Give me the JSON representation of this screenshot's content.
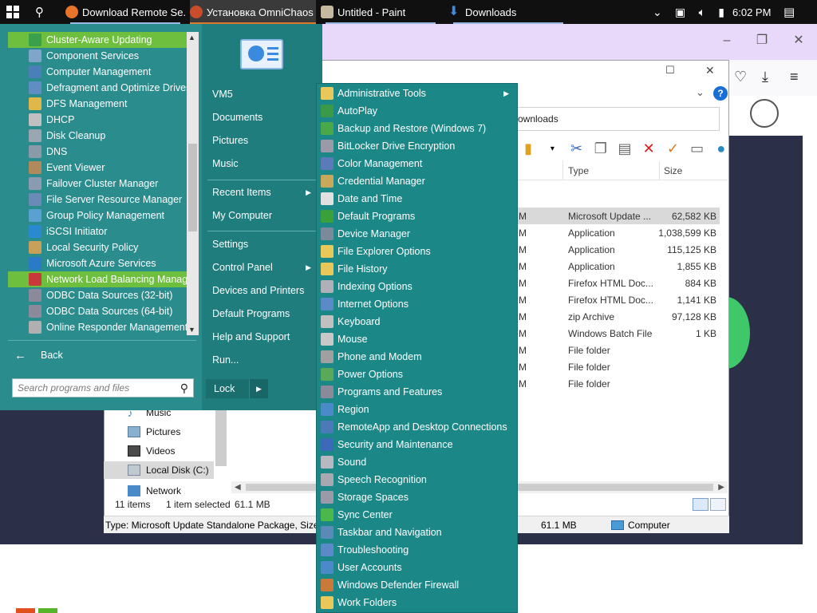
{
  "taskbar": {
    "apps": [
      {
        "label": "Download Remote Se...",
        "color": "#e8742a"
      },
      {
        "label": "Установка OmniChaos",
        "color": "#c94d2a"
      },
      {
        "label": "Untitled - Paint",
        "color": "#c7b8a0"
      },
      {
        "label": "Downloads",
        "color": "#3f8be0"
      }
    ],
    "time": "6:02 PM"
  },
  "explorer": {
    "address": "ownloads",
    "columns": {
      "type": "Type",
      "size": "Size"
    },
    "files": [
      {
        "date": "M",
        "type": "Microsoft Update ...",
        "size": "62,582 KB",
        "selected": true
      },
      {
        "date": "M",
        "type": "Application",
        "size": "1,038,599 KB"
      },
      {
        "date": "M",
        "type": "Application",
        "size": "115,125 KB"
      },
      {
        "date": "M",
        "type": "Application",
        "size": "1,855 KB"
      },
      {
        "date": "M",
        "type": "Firefox HTML Doc...",
        "size": "884 KB"
      },
      {
        "date": "M",
        "type": "Firefox HTML Doc...",
        "size": "1,141 KB"
      },
      {
        "date": "M",
        "type": "zip Archive",
        "size": "97,128 KB"
      },
      {
        "date": "M",
        "type": "Windows Batch File",
        "size": "1 KB"
      },
      {
        "date": "M",
        "type": "File folder",
        "size": ""
      },
      {
        "date": "M",
        "type": "File folder",
        "size": ""
      },
      {
        "date": "M",
        "type": "File folder",
        "size": ""
      }
    ],
    "nav": {
      "music": "Music",
      "pictures": "Pictures",
      "videos": "Videos",
      "local_disk": "Local Disk (C:)",
      "network": "Network"
    },
    "status": {
      "items": "11 items",
      "selected": "1 item selected",
      "size": "61.1 MB"
    },
    "info": {
      "type_text": "Type: Microsoft Update Standalone Package, Size:",
      "size": "61.1 MB",
      "location": "Computer"
    }
  },
  "start_menu": {
    "programs": [
      {
        "label": "Cluster-Aware Updating",
        "icon_color": "#3aa04a",
        "highlighted": true
      },
      {
        "label": "Component Services",
        "icon_color": "#7fa6c9"
      },
      {
        "label": "Computer Management",
        "icon_color": "#4a7fb8"
      },
      {
        "label": "Defragment and Optimize Drives",
        "icon_color": "#5f8fc2"
      },
      {
        "label": "DFS Management",
        "icon_color": "#e0b84a"
      },
      {
        "label": "DHCP",
        "icon_color": "#c0c0c0"
      },
      {
        "label": "Disk Cleanup",
        "icon_color": "#9aa6b0"
      },
      {
        "label": "DNS",
        "icon_color": "#8a9aa8"
      },
      {
        "label": "Event Viewer",
        "icon_color": "#b08a5a"
      },
      {
        "label": "Failover Cluster Manager",
        "icon_color": "#8a9ab0"
      },
      {
        "label": "File Server Resource Manager",
        "icon_color": "#6a8ab8"
      },
      {
        "label": "Group Policy Management",
        "icon_color": "#5aa0d0"
      },
      {
        "label": "iSCSI Initiator",
        "icon_color": "#2a8ad0"
      },
      {
        "label": "Local Security Policy",
        "icon_color": "#c8a05a"
      },
      {
        "label": "Microsoft Azure Services",
        "icon_color": "#2a7ac8"
      },
      {
        "label": "Network Load Balancing Manager",
        "icon_color": "#c83a3a",
        "highlighted": true
      },
      {
        "label": "ODBC Data Sources (32-bit)",
        "icon_color": "#8a8a9a"
      },
      {
        "label": "ODBC Data Sources (64-bit)",
        "icon_color": "#8a8a9a"
      },
      {
        "label": "Online Responder Management",
        "icon_color": "#b0b0b0"
      }
    ],
    "back_label": "Back",
    "search_placeholder": "Search programs and files",
    "right_links": [
      {
        "label": "VM5",
        "arrow": false
      },
      {
        "label": "Documents",
        "arrow": false
      },
      {
        "label": "Pictures",
        "arrow": false
      },
      {
        "label": "Music",
        "arrow": false
      },
      {
        "label": "Recent Items",
        "arrow": true
      },
      {
        "label": "My Computer",
        "arrow": false
      },
      {
        "label": "Settings",
        "arrow": false
      },
      {
        "label": "Control Panel",
        "arrow": true
      },
      {
        "label": "Devices and Printers",
        "arrow": false
      },
      {
        "label": "Default Programs",
        "arrow": false
      },
      {
        "label": "Help and Support",
        "arrow": false
      },
      {
        "label": "Run...",
        "arrow": false
      }
    ],
    "lock_label": "Lock"
  },
  "control_panel": {
    "items": [
      {
        "label": "Administrative Tools",
        "icon_color": "#e8c85a",
        "arrow": true
      },
      {
        "label": "AutoPlay",
        "icon_color": "#3a9a4a"
      },
      {
        "label": "Backup and Restore (Windows 7)",
        "icon_color": "#4aa84a"
      },
      {
        "label": "BitLocker Drive Encryption",
        "icon_color": "#9a9aa8"
      },
      {
        "label": "Color Management",
        "icon_color": "#5a7ab8"
      },
      {
        "label": "Credential Manager",
        "icon_color": "#c8a85a"
      },
      {
        "label": "Date and Time",
        "icon_color": "#e0e0e0"
      },
      {
        "label": "Default Programs",
        "icon_color": "#3aa03a"
      },
      {
        "label": "Device Manager",
        "icon_color": "#7a8a9a"
      },
      {
        "label": "File Explorer Options",
        "icon_color": "#e8c85a"
      },
      {
        "label": "File History",
        "icon_color": "#e8c85a"
      },
      {
        "label": "Indexing Options",
        "icon_color": "#b0b0b8"
      },
      {
        "label": "Internet Options",
        "icon_color": "#5a8ac8"
      },
      {
        "label": "Keyboard",
        "icon_color": "#c0c0c0"
      },
      {
        "label": "Mouse",
        "icon_color": "#c8c8c8"
      },
      {
        "label": "Phone and Modem",
        "icon_color": "#a0a0a0"
      },
      {
        "label": "Power Options",
        "icon_color": "#5aa85a"
      },
      {
        "label": "Programs and Features",
        "icon_color": "#8a8a9a"
      },
      {
        "label": "Region",
        "icon_color": "#4a8ac8"
      },
      {
        "label": "RemoteApp and Desktop Connections",
        "icon_color": "#4a7ab8"
      },
      {
        "label": "Security and Maintenance",
        "icon_color": "#3a6ab8"
      },
      {
        "label": "Sound",
        "icon_color": "#b8b8c0"
      },
      {
        "label": "Speech Recognition",
        "icon_color": "#a8a8b0"
      },
      {
        "label": "Storage Spaces",
        "icon_color": "#9a9aa8"
      },
      {
        "label": "Sync Center",
        "icon_color": "#4ab84a"
      },
      {
        "label": "Taskbar and Navigation",
        "icon_color": "#5a8ab8"
      },
      {
        "label": "Troubleshooting",
        "icon_color": "#5a8ac8"
      },
      {
        "label": "User Accounts",
        "icon_color": "#4a8ac8"
      },
      {
        "label": "Windows Defender Firewall",
        "icon_color": "#c87a3a"
      },
      {
        "label": "Work Folders",
        "icon_color": "#e8c85a"
      }
    ]
  }
}
